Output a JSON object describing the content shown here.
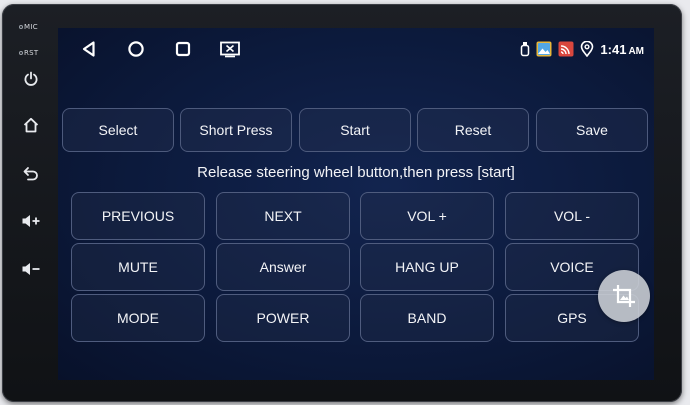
{
  "bezel": {
    "mic_label": "MIC",
    "rst_label": "RST",
    "buttons": [
      {
        "icon": "power-icon"
      },
      {
        "icon": "home-icon"
      },
      {
        "icon": "back-icon"
      },
      {
        "icon": "volume-up-icon"
      },
      {
        "icon": "volume-down-icon"
      }
    ]
  },
  "status_bar": {
    "nav": [
      {
        "icon": "back-triangle-icon"
      },
      {
        "icon": "home-circle-icon"
      },
      {
        "icon": "recents-square-icon"
      },
      {
        "icon": "screenshot-icon"
      }
    ],
    "status_icons": [
      "usb-icon",
      "gallery-icon",
      "cast-icon",
      "location-icon"
    ],
    "time": "1:41",
    "ampm": "AM"
  },
  "mode_buttons": [
    "Select",
    "Short Press",
    "Start",
    "Reset",
    "Save"
  ],
  "instruction": "Release steering wheel button,then press [start]",
  "keys": [
    [
      "PREVIOUS",
      "NEXT",
      "VOL +",
      "VOL -"
    ],
    [
      "MUTE",
      "Answer",
      "HANG UP",
      "VOICE"
    ],
    [
      "MODE",
      "POWER",
      "BAND",
      "GPS"
    ]
  ],
  "floating_button": {
    "icon": "image-crop-icon"
  }
}
